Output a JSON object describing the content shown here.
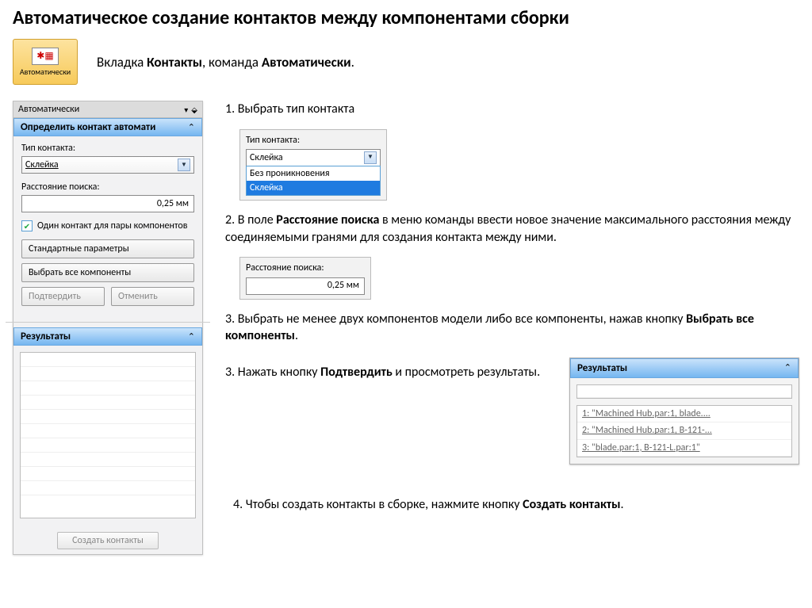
{
  "title": "Автоматическое создание контактов между компонентами сборки",
  "ribbon": {
    "label": "Автоматически"
  },
  "intro": {
    "pre": "Вкладка ",
    "b1": "Контакты",
    "mid": ", команда ",
    "b2": "Автоматически",
    "post": "."
  },
  "panel": {
    "tab": "Автоматически",
    "header": "Определить контакт автомати",
    "type_label": "Тип контакта:",
    "type_value": "Склейка",
    "dist_label": "Расстояние поиска:",
    "dist_value": "0,25 мм",
    "chk_label": "Один контакт для пары компонентов",
    "std_params": "Стандартные параметры",
    "select_all": "Выбрать все компоненты",
    "confirm": "Подтвердить",
    "cancel": "Отменить",
    "results_header": "Результаты",
    "create_btn": "Создать контакты"
  },
  "steps": {
    "s1": "1. Выбрать тип контакта",
    "s2_pre": "2. В поле ",
    "s2_b": "Расстояние поиска",
    "s2_post": " в меню команды ввести новое значение максимального расстояния между соединяемыми гранями для создания контакта между ними.",
    "s3a_pre": "3. Выбрать не менее двух компонентов модели либо все компоненты, нажав кнопку ",
    "s3a_b": "Выбрать все компоненты",
    "s3a_post": ".",
    "s3b_pre": "3. Нажать кнопку ",
    "s3b_b": "Подтвердить",
    "s3b_post": " и просмотреть результаты.",
    "s4_pre": "4. Чтобы создать контакты в сборке, нажмите кнопку ",
    "s4_b": "Создать контакты",
    "s4_post": "."
  },
  "dropdown": {
    "type_label": "Тип контакта:",
    "selected": "Склейка",
    "opt1": "Без проникновения",
    "opt2": "Склейка"
  },
  "mini_dist": {
    "label": "Расстояние поиска:",
    "value": "0,25 мм"
  },
  "results_preview": {
    "header": "Результаты",
    "r1": "1: \"Machined Hub.par:1, blade....",
    "r2": "2: \"Machined Hub.par:1, B-121-...",
    "r3": "3: \"blade.par:1, B-121-L.par:1\""
  }
}
